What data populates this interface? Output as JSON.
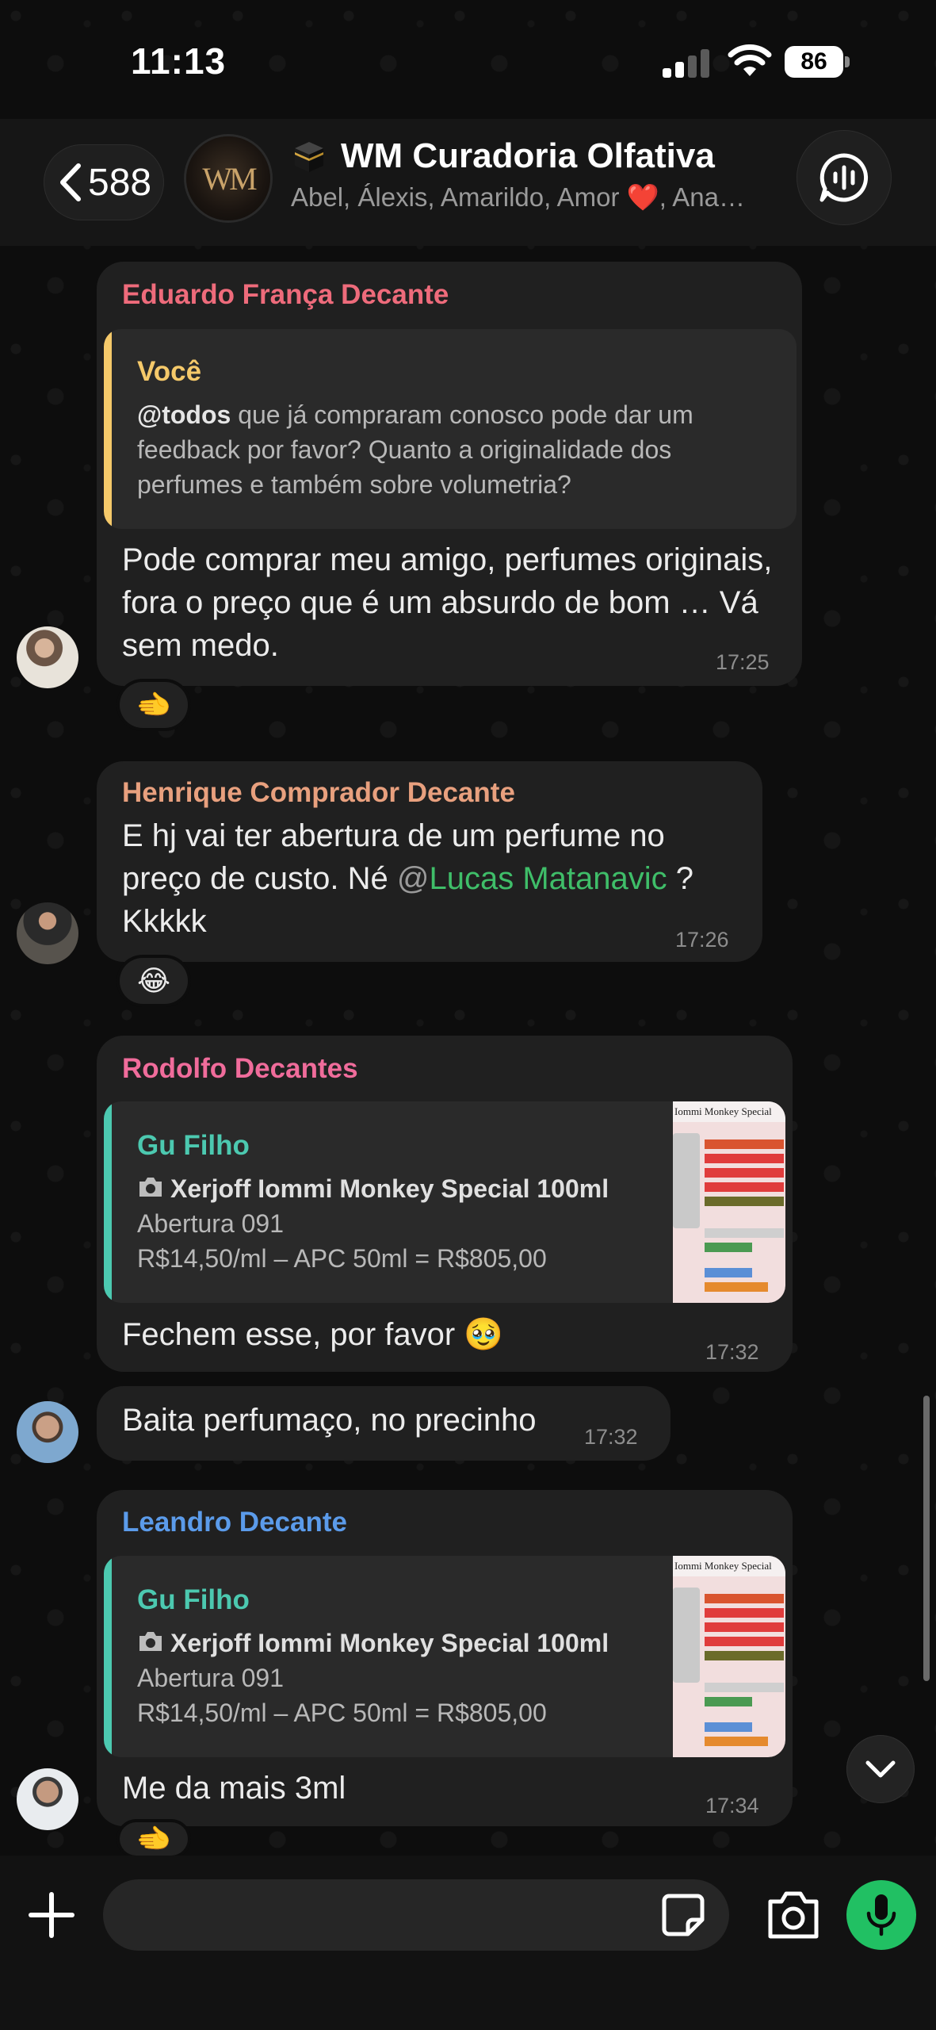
{
  "status_bar": {
    "time": "11:13",
    "battery": "86"
  },
  "header": {
    "back_count": "588",
    "group_avatar_text": "WM",
    "group_name": "WM Curadoria Olfativa",
    "members": "Abel, Álexis, Amarildo, Amor ❤️, Ana…"
  },
  "messages": [
    {
      "sender": "Eduardo França Decante",
      "sender_color": "#ee6b7b",
      "quote": {
        "name": "Você",
        "name_color": "#f5c96a",
        "bar_color": "#f5c96a",
        "mention": "@todos",
        "text": " que já compraram conosco pode dar um feedback por favor? Quanto a originalidade dos perfumes e também sobre volumetria?"
      },
      "text": "Pode comprar meu amigo, perfumes originais, fora o preço que é um absurdo de bom … Vá sem medo.",
      "time": "17:25",
      "reaction": "🫲"
    },
    {
      "sender": "Henrique Comprador Decante",
      "sender_color": "#e8a07e",
      "text_before": "E hj vai ter abertura de um perfume no preço de custo. Né ",
      "mention_at": "@",
      "mention_name": "Lucas Matanavic",
      "text_after": " ? Kkkkk",
      "time": "17:26",
      "reaction": "😂"
    },
    {
      "sender": "Rodolfo Decantes",
      "sender_color": "#f06c9b",
      "quote": {
        "name": "Gu Filho",
        "name_color": "#4cc9b0",
        "bar_color": "#4cc9b0",
        "title": "Xerjoff Iommi Monkey Special 100ml",
        "line1": "Abertura 091",
        "line2": "R$14,50/ml – APC 50ml = R$805,00",
        "thumb_label": "Iommi Monkey Special"
      },
      "text": "Fechem esse, por favor 🥹",
      "time": "17:32"
    },
    {
      "text": "Baita perfumaço, no precinho",
      "time": "17:32"
    },
    {
      "sender": "Leandro Decante",
      "sender_color": "#5b9bea",
      "quote": {
        "name": "Gu Filho",
        "name_color": "#4cc9b0",
        "bar_color": "#4cc9b0",
        "title": "Xerjoff Iommi Monkey Special 100ml",
        "line1": "Abertura 091",
        "line2": "R$14,50/ml – APC 50ml = R$805,00",
        "thumb_label": "Iommi Monkey Special"
      },
      "text": "Me da mais 3ml",
      "time": "17:34",
      "reaction": "🫲"
    }
  ],
  "composer": {
    "placeholder": ""
  },
  "colors": {
    "accent_green": "#21c063",
    "bubble": "#202020"
  },
  "icons": [
    "chevron-left-icon",
    "kaaba-icon",
    "audio-chat-icon",
    "plus-icon",
    "sticker-icon",
    "camera-icon",
    "microphone-icon",
    "chevron-down-icon"
  ]
}
